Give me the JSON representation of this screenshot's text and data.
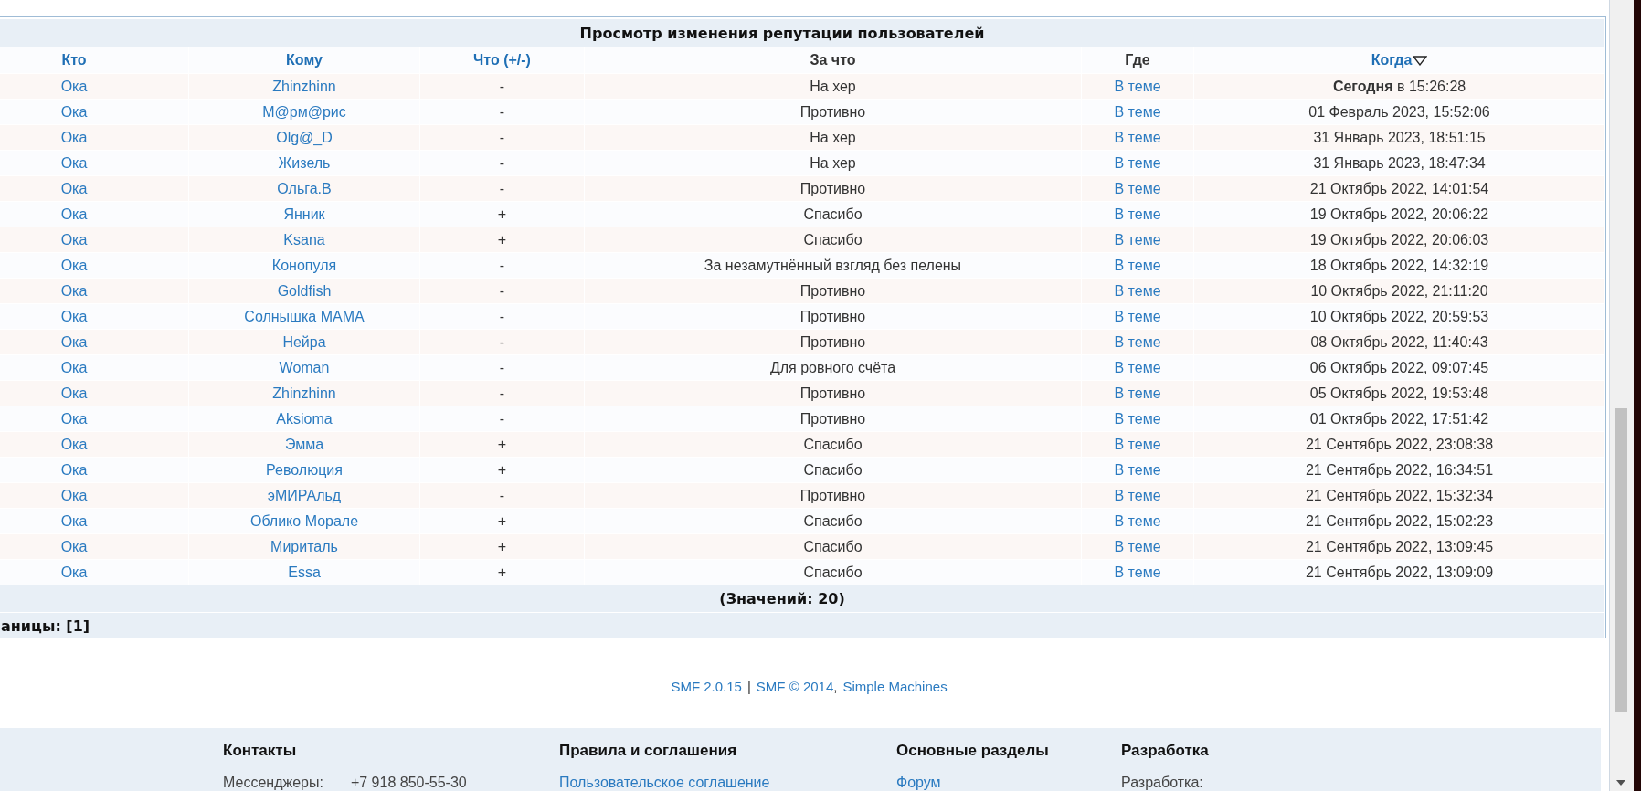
{
  "table": {
    "title": "Просмотр изменения репутации пользователей",
    "columns": [
      {
        "label": "Кто",
        "kind": "link",
        "sorted": false
      },
      {
        "label": "Кому",
        "kind": "link",
        "sorted": false
      },
      {
        "label": "Что (+/-)",
        "kind": "link",
        "sorted": false
      },
      {
        "label": "За что",
        "kind": "text",
        "sorted": false
      },
      {
        "label": "Где",
        "kind": "text",
        "sorted": false
      },
      {
        "label": "Когда",
        "kind": "link",
        "sorted": true
      }
    ],
    "rows": [
      {
        "who": "Ока",
        "to": "Zhinzhinn",
        "sign": "-",
        "reason": "На хер",
        "where": "В теме",
        "when": "**Сегодня** в 15:26:28"
      },
      {
        "who": "Ока",
        "to": "М@рм@рис",
        "sign": "-",
        "reason": "Противно",
        "where": "В теме",
        "when": "01 Февраль 2023, 15:52:06"
      },
      {
        "who": "Ока",
        "to": "Olg@_D",
        "sign": "-",
        "reason": "На хер",
        "where": "В теме",
        "when": "31 Январь 2023, 18:51:15"
      },
      {
        "who": "Ока",
        "to": "Жизель",
        "sign": "-",
        "reason": "На хер",
        "where": "В теме",
        "when": "31 Январь 2023, 18:47:34"
      },
      {
        "who": "Ока",
        "to": "Ольга.В",
        "sign": "-",
        "reason": "Противно",
        "where": "В теме",
        "when": "21 Октябрь 2022, 14:01:54"
      },
      {
        "who": "Ока",
        "to": "Янник",
        "sign": "+",
        "reason": "Спасибо",
        "where": "В теме",
        "when": "19 Октябрь 2022, 20:06:22"
      },
      {
        "who": "Ока",
        "to": "Ksana",
        "sign": "+",
        "reason": "Спасибо",
        "where": "В теме",
        "when": "19 Октябрь 2022, 20:06:03"
      },
      {
        "who": "Ока",
        "to": "Конопуля",
        "sign": "-",
        "reason": "За незамутнённый взгляд без пелены",
        "where": "В теме",
        "when": "18 Октябрь 2022, 14:32:19"
      },
      {
        "who": "Ока",
        "to": "Goldfish",
        "sign": "-",
        "reason": "Противно",
        "where": "В теме",
        "when": "10 Октябрь 2022, 21:11:20"
      },
      {
        "who": "Ока",
        "to": "Солнышка МАМА",
        "sign": "-",
        "reason": "Противно",
        "where": "В теме",
        "when": "10 Октябрь 2022, 20:59:53"
      },
      {
        "who": "Ока",
        "to": "Нейра",
        "sign": "-",
        "reason": "Противно",
        "where": "В теме",
        "when": "08 Октябрь 2022, 11:40:43"
      },
      {
        "who": "Ока",
        "to": "Woman",
        "sign": "-",
        "reason": "Для ровного счёта",
        "where": "В теме",
        "when": "06 Октябрь 2022, 09:07:45"
      },
      {
        "who": "Ока",
        "to": "Zhinzhinn",
        "sign": "-",
        "reason": "Противно",
        "where": "В теме",
        "when": "05 Октябрь 2022, 19:53:48"
      },
      {
        "who": "Ока",
        "to": "Aksioma",
        "sign": "-",
        "reason": "Противно",
        "where": "В теме",
        "when": "01 Октябрь 2022, 17:51:42"
      },
      {
        "who": "Ока",
        "to": "Эмма",
        "sign": "+",
        "reason": "Спасибо",
        "where": "В теме",
        "when": "21 Сентябрь 2022, 23:08:38"
      },
      {
        "who": "Ока",
        "to": "Революция",
        "sign": "+",
        "reason": "Спасибо",
        "where": "В теме",
        "when": "21 Сентябрь 2022, 16:34:51"
      },
      {
        "who": "Ока",
        "to": "эМИРАльд",
        "sign": "-",
        "reason": "Противно",
        "where": "В теме",
        "when": "21 Сентябрь 2022, 15:32:34"
      },
      {
        "who": "Ока",
        "to": "Облико Морале",
        "sign": "+",
        "reason": "Спасибо",
        "where": "В теме",
        "when": "21 Сентябрь 2022, 15:02:23"
      },
      {
        "who": "Ока",
        "to": "Мириталь",
        "sign": "+",
        "reason": "Спасибо",
        "where": "В теме",
        "when": "21 Сентябрь 2022, 13:09:45"
      },
      {
        "who": "Ока",
        "to": "Essa",
        "sign": "+",
        "reason": "Спасибо",
        "where": "В теме",
        "when": "21 Сентябрь 2022, 13:09:09"
      }
    ],
    "total": "(Значений: 20)",
    "pages": "аницы: [1]"
  },
  "credits": {
    "version": "SMF 2.0.15",
    "separator": "|",
    "copyright": "SMF © 2014",
    "comma": ",",
    "vendor": "Simple Machines"
  },
  "footer": [
    {
      "heading": "Контакты",
      "kind": "pair",
      "label": "Мессенджеры:",
      "value": "+7 918 850-55-30"
    },
    {
      "heading": "Правила и соглашения",
      "kind": "link",
      "value": "Пользовательское соглашение"
    },
    {
      "heading": "Основные разделы",
      "kind": "link",
      "value": "Форум"
    },
    {
      "heading": "Разработка",
      "kind": "text",
      "value": "Разработка:"
    }
  ]
}
